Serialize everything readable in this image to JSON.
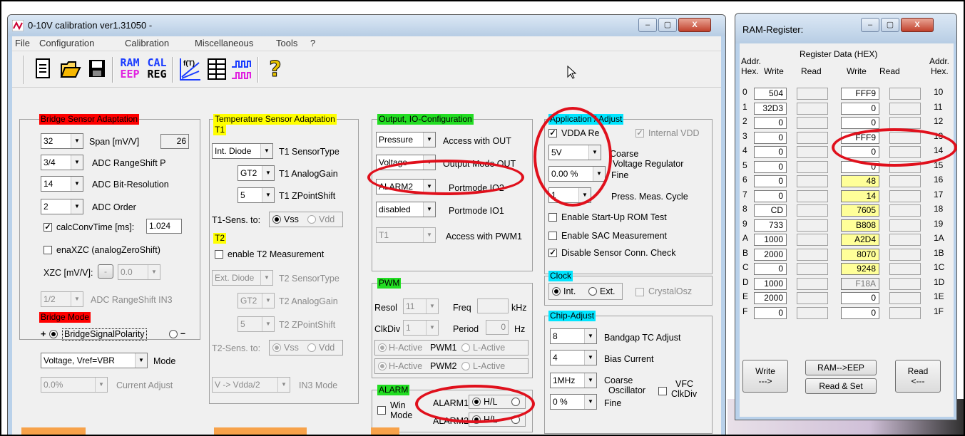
{
  "main_window": {
    "title": "0-10V calibration ver1.31050 -",
    "controls": {
      "minimize": "–",
      "maximize": "▢",
      "close": "X"
    },
    "menu": [
      "File",
      "Configuration",
      "Calibration",
      "Miscellaneous",
      "Tools",
      "?"
    ],
    "toolbar": {
      "ram_eep": [
        "RAM",
        "EEP"
      ],
      "cal_reg": [
        "CAL",
        "REG"
      ],
      "func_label": "f(T)",
      "help": "?"
    }
  },
  "bridge": {
    "title": "Bridge Sensor Adaptation",
    "span_value": "32",
    "span_label": "Span [mV/V]",
    "span_result": "26",
    "rangeshift_value": "3/4",
    "rangeshift_label": "ADC RangeShift P",
    "bitres_value": "14",
    "bitres_label": "ADC Bit-Resolution",
    "order_value": "2",
    "order_label": "ADC Order",
    "calcconv_label": "calcConvTime [ms]:",
    "calcconv_value": "1.024",
    "enaxzc_label": "enaXZC (analogZeroShift)",
    "xzc_label": "XZC [mV/V]:",
    "xzc_sign": "-",
    "xzc_value": "0.0",
    "in3_value": "1/2",
    "in3_label": "ADC RangeShift IN3"
  },
  "bridge_mode": {
    "title": "Bridge Mode",
    "plus": "+",
    "polarity_label": "BridgeSignalPolarity",
    "minus": "–",
    "mode_value": "Voltage, Vref=VBR",
    "mode_label": "Mode",
    "current_value": "0.0%",
    "current_label": "Current Adjust"
  },
  "temp": {
    "title": "Temperature Sensor Adaptation",
    "t1": "T1",
    "t1_type_value": "Int. Diode",
    "t1_type_label": "T1 SensorType",
    "t1_gain_value": "GT2",
    "t1_gain_label": "T1 AnalogGain",
    "t1_zp_value": "5",
    "t1_zp_label": "T1 ZPointShift",
    "t1_sens_label": "T1-Sens. to:",
    "vss": "Vss",
    "vdd": "Vdd",
    "t2": "T2",
    "t2_enable_label": "enable T2 Measurement",
    "t2_type_value": "Ext. Diode",
    "t2_type_label": "T2 SensorType",
    "t2_gain_value": "GT2",
    "t2_gain_label": "T2 AnalogGain",
    "t2_zp_value": "5",
    "t2_zp_label": "T2 ZPointShift",
    "t2_sens_label": "T2-Sens. to:",
    "in3_mode_value": "V -> Vdda/2",
    "in3_mode_label": "IN3 Mode"
  },
  "output": {
    "title": "Output, IO-Configuration",
    "access_out_value": "Pressure",
    "access_out_label": "Access with OUT",
    "outmode_value": "Voltage",
    "outmode_label": "Output Mode OUT",
    "io2_value": "ALARM2",
    "io2_label": "Portmode IO2",
    "io1_value": "disabled",
    "io1_label": "Portmode IO1",
    "pwm1_value": "T1",
    "pwm1_label": "Access with PWM1"
  },
  "pwm": {
    "title": "PWM",
    "resol_label": "Resol",
    "resol_value": "11",
    "freq_label": "Freq",
    "freq_unit": "kHz",
    "clkdiv_label": "ClkDiv",
    "clkdiv_value": "1",
    "period_label": "Period",
    "period_value": "0",
    "period_unit": "Hz",
    "hactive": "H-Active",
    "lactive": "L-Active",
    "pwm1": "PWM1",
    "pwm2": "PWM2"
  },
  "alarm": {
    "title": "ALARM",
    "win_label": "Win",
    "mode_label": "Mode",
    "alarm1": "ALARM1",
    "alarm2": "ALARM2",
    "hl": "H/L"
  },
  "app": {
    "title": "Application / Adjust",
    "vdda_label": "VDDA Re",
    "internal_vdd": "Internal VDD",
    "coarse_value": "5V",
    "coarse_label": "Coarse",
    "vreg_label": "Voltage Regulator",
    "fine_value": "0.00 %",
    "fine_label": "Fine",
    "cycle_value": "1",
    "cycle_label": "Press. Meas. Cycle",
    "rom_label": "Enable Start-Up ROM Test",
    "sac_label": "Enable SAC Measurement",
    "conn_label": "Disable Sensor Conn. Check"
  },
  "clock": {
    "title": "Clock",
    "int": "Int.",
    "ext": "Ext.",
    "crystal": "CrystalOsz"
  },
  "chip": {
    "title": "Chip-Adjust",
    "bandgap_value": "8",
    "bandgap_label": "Bandgap TC Adjust",
    "bias_value": "4",
    "bias_label": "Bias Current",
    "osc_value": "1MHz",
    "coarse_label": "Coarse",
    "osc_label": "Oscillator",
    "fine_value": "0 %",
    "fine_label": "Fine",
    "vfc_label": "VFC",
    "clkdiv_label": "ClkDiv"
  },
  "ram": {
    "title": "RAM-Register:",
    "header_group": "Register Data (HEX)",
    "addr_l1": "Addr.",
    "addr_l2": "Hex.",
    "write": "Write",
    "read": "Read",
    "addr_r1": "Addr.",
    "addr_r2": "Hex.",
    "left": [
      {
        "addr": "0",
        "write": "504"
      },
      {
        "addr": "1",
        "write": "32D3"
      },
      {
        "addr": "2",
        "write": "0"
      },
      {
        "addr": "3",
        "write": "0"
      },
      {
        "addr": "4",
        "write": "0"
      },
      {
        "addr": "5",
        "write": "0"
      },
      {
        "addr": "6",
        "write": "0"
      },
      {
        "addr": "7",
        "write": "0"
      },
      {
        "addr": "8",
        "write": "CD"
      },
      {
        "addr": "9",
        "write": "733"
      },
      {
        "addr": "A",
        "write": "1000"
      },
      {
        "addr": "B",
        "write": "2000"
      },
      {
        "addr": "C",
        "write": "0"
      },
      {
        "addr": "D",
        "write": "1000"
      },
      {
        "addr": "E",
        "write": "2000"
      },
      {
        "addr": "F",
        "write": "0"
      }
    ],
    "right": [
      {
        "addr": "10",
        "write": "FFF9",
        "style": "w"
      },
      {
        "addr": "11",
        "write": "0",
        "style": "w"
      },
      {
        "addr": "12",
        "write": "0",
        "style": "w"
      },
      {
        "addr": "13",
        "write": "FFF9",
        "style": "w"
      },
      {
        "addr": "14",
        "write": "0",
        "style": "w"
      },
      {
        "addr": "15",
        "write": "0",
        "style": "w"
      },
      {
        "addr": "16",
        "write": "48",
        "style": "y"
      },
      {
        "addr": "17",
        "write": "14",
        "style": "y"
      },
      {
        "addr": "18",
        "write": "7605",
        "style": "y"
      },
      {
        "addr": "19",
        "write": "B808",
        "style": "y"
      },
      {
        "addr": "1A",
        "write": "A2D4",
        "style": "y"
      },
      {
        "addr": "1B",
        "write": "8070",
        "style": "y"
      },
      {
        "addr": "1C",
        "write": "9248",
        "style": "y"
      },
      {
        "addr": "1D",
        "write": "F18A",
        "style": "d"
      },
      {
        "addr": "1E",
        "write": "0",
        "style": "w"
      },
      {
        "addr": "1F",
        "write": "0",
        "style": "w"
      }
    ],
    "btn_write": "Write",
    "btn_write_arrow": "--->",
    "btn_ram_eep": "RAM-->EEP",
    "btn_read_set": "Read & Set",
    "btn_read": "Read",
    "btn_read_arrow": "<---"
  }
}
